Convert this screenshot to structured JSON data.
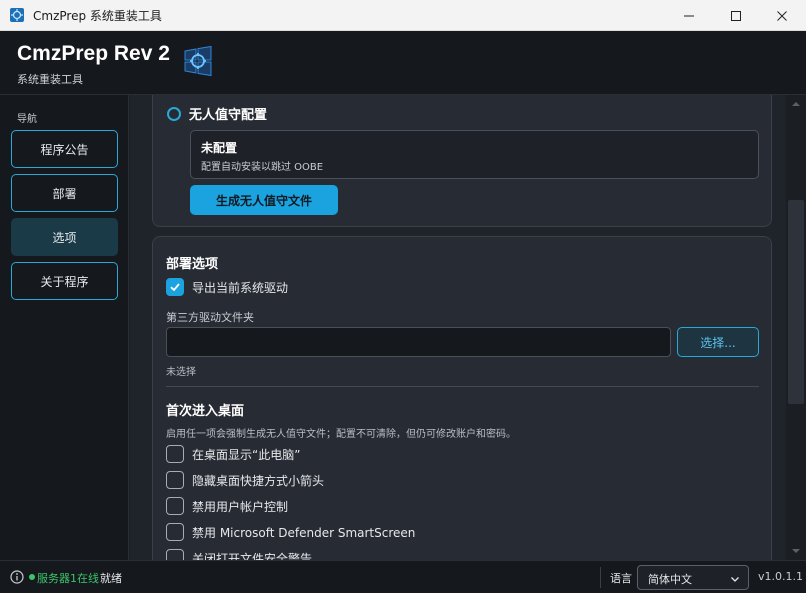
{
  "window": {
    "title": "CmzPrep 系统重装工具"
  },
  "header": {
    "title": "CmzPrep Rev 2",
    "subtitle": "系统重装工具"
  },
  "sidebar": {
    "label": "导航",
    "items": [
      {
        "label": "程序公告",
        "active": false
      },
      {
        "label": "部署",
        "active": false
      },
      {
        "label": "选项",
        "active": true
      },
      {
        "label": "关于程序",
        "active": false
      }
    ]
  },
  "unattended": {
    "title": "无人值守配置",
    "status_title": "未配置",
    "status_desc": "配置自动安装以跳过 OOBE",
    "button": "生成无人值守文件"
  },
  "deploy_options": {
    "title": "部署选项",
    "export_driver_label": "导出当前系统驱动",
    "export_driver_checked": true,
    "third_party_label": "第三方驱动文件夹",
    "third_party_value": "",
    "choose_button": "选择...",
    "not_selected": "未选择"
  },
  "first_desktop": {
    "title": "首次进入桌面",
    "note": "启用任一项会强制生成无人值守文件；配置不可清除，但仍可修改账户和密码。",
    "options": [
      {
        "label": "在桌面显示“此电脑”",
        "checked": false
      },
      {
        "label": "隐藏桌面快捷方式小箭头",
        "checked": false
      },
      {
        "label": "禁用用户帐户控制",
        "checked": false
      },
      {
        "label": "禁用 Microsoft Defender SmartScreen",
        "checked": false
      },
      {
        "label": "关闭打开文件安全警告",
        "checked": false
      }
    ]
  },
  "statusbar": {
    "server": "服务器1在线",
    "state": "就绪",
    "language_label": "语言",
    "language_value": "简体中文",
    "version": "v1.0.1.1"
  },
  "colors": {
    "accent": "#1ba3df",
    "online": "#3cc46b"
  }
}
